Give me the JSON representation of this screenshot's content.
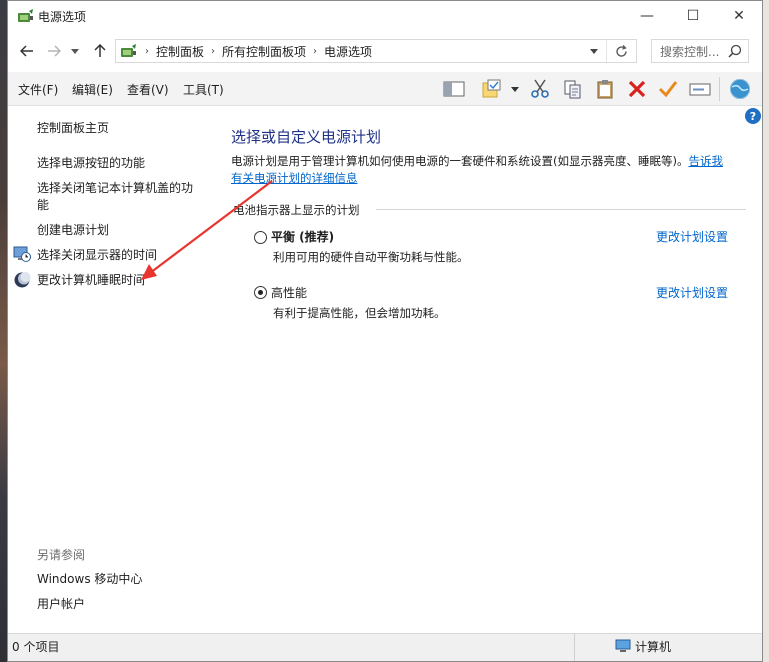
{
  "window": {
    "title": "电源选项",
    "minimize_glyph": "—",
    "maximize_glyph": "☐",
    "close_glyph": "✕"
  },
  "address": {
    "crumbs": [
      "控制面板",
      "所有控制面板项",
      "电源选项"
    ],
    "search_placeholder": "搜索控制..."
  },
  "menu": {
    "file": "文件(F)",
    "edit": "编辑(E)",
    "view": "查看(V)",
    "tools": "工具(T)"
  },
  "sidebar": {
    "home": "控制面板主页",
    "items": [
      {
        "label": "选择电源按钮的功能"
      },
      {
        "label": "选择关闭笔记本计算机盖的功能"
      },
      {
        "label": "创建电源计划"
      },
      {
        "label": "选择关闭显示器的时间",
        "icon": "monitor-clock-icon"
      },
      {
        "label": "更改计算机睡眠时间",
        "icon": "moon-icon"
      }
    ],
    "see_also_title": "另请参阅",
    "see_also": [
      "Windows 移动中心",
      "用户帐户"
    ]
  },
  "main": {
    "title": "选择或自定义电源计划",
    "description": "电源计划是用于管理计算机如何使用电源的一套硬件和系统设置(如显示器亮度、睡眠等)。",
    "desc_link_a": "告诉我",
    "desc_link_b": "有关电源计划的详细信息",
    "section_label": "电池指示器上显示的计划",
    "plans": [
      {
        "name": "平衡 (推荐)",
        "desc": "利用可用的硬件自动平衡功耗与性能。",
        "selected": false,
        "link": "更改计划设置"
      },
      {
        "name": "高性能",
        "desc": "有利于提高性能，但会增加功耗。",
        "selected": true,
        "link": "更改计划设置"
      }
    ]
  },
  "status": {
    "count": "0 个项目",
    "location": "计算机"
  },
  "colors": {
    "title_blue": "#1e3287",
    "link_blue": "#0066cc",
    "annotation_red": "#e8352e"
  }
}
